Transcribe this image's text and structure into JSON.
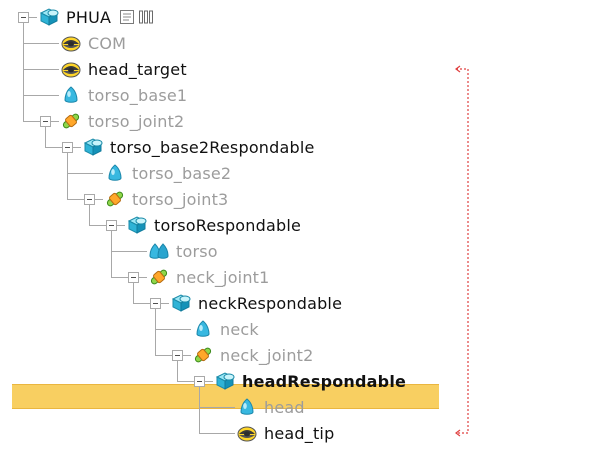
{
  "tree": {
    "nodes": [
      {
        "label": "PHUA",
        "icon": "shape-icon",
        "level": 0,
        "state": "active"
      },
      {
        "label": "COM",
        "icon": "dummy-icon",
        "level": 1,
        "state": "dim"
      },
      {
        "label": "head_target",
        "icon": "dummy-icon",
        "level": 1,
        "state": "active"
      },
      {
        "label": "torso_base1",
        "icon": "mesh-icon",
        "level": 1,
        "state": "dim"
      },
      {
        "label": "torso_joint2",
        "icon": "joint-icon",
        "level": 1,
        "state": "dim"
      },
      {
        "label": "torso_base2Respondable",
        "icon": "shape-icon",
        "level": 2,
        "state": "active"
      },
      {
        "label": "torso_base2",
        "icon": "mesh-icon",
        "level": 3,
        "state": "dim"
      },
      {
        "label": "torso_joint3",
        "icon": "joint-icon",
        "level": 3,
        "state": "dim"
      },
      {
        "label": "torsoRespondable",
        "icon": "shape-icon",
        "level": 4,
        "state": "active"
      },
      {
        "label": "torso",
        "icon": "multi-mesh-icon",
        "level": 5,
        "state": "dim"
      },
      {
        "label": "neck_joint1",
        "icon": "joint-icon",
        "level": 5,
        "state": "dim"
      },
      {
        "label": "neckRespondable",
        "icon": "shape-icon",
        "level": 6,
        "state": "active"
      },
      {
        "label": "neck",
        "icon": "mesh-icon",
        "level": 7,
        "state": "dim"
      },
      {
        "label": "neck_joint2",
        "icon": "joint-icon",
        "level": 7,
        "state": "dim"
      },
      {
        "label": "headRespondable",
        "icon": "shape-icon",
        "level": 8,
        "state": "selected"
      },
      {
        "label": "head",
        "icon": "mesh-icon",
        "level": 9,
        "state": "dim"
      },
      {
        "label": "head_tip",
        "icon": "dummy-icon",
        "level": 9,
        "state": "active"
      }
    ],
    "selected_label": "headRespondable",
    "root_extra_icons": [
      "script-icon",
      "bars-icon"
    ],
    "link_color": "#e04040",
    "highlight_color": "#f8cf61"
  }
}
